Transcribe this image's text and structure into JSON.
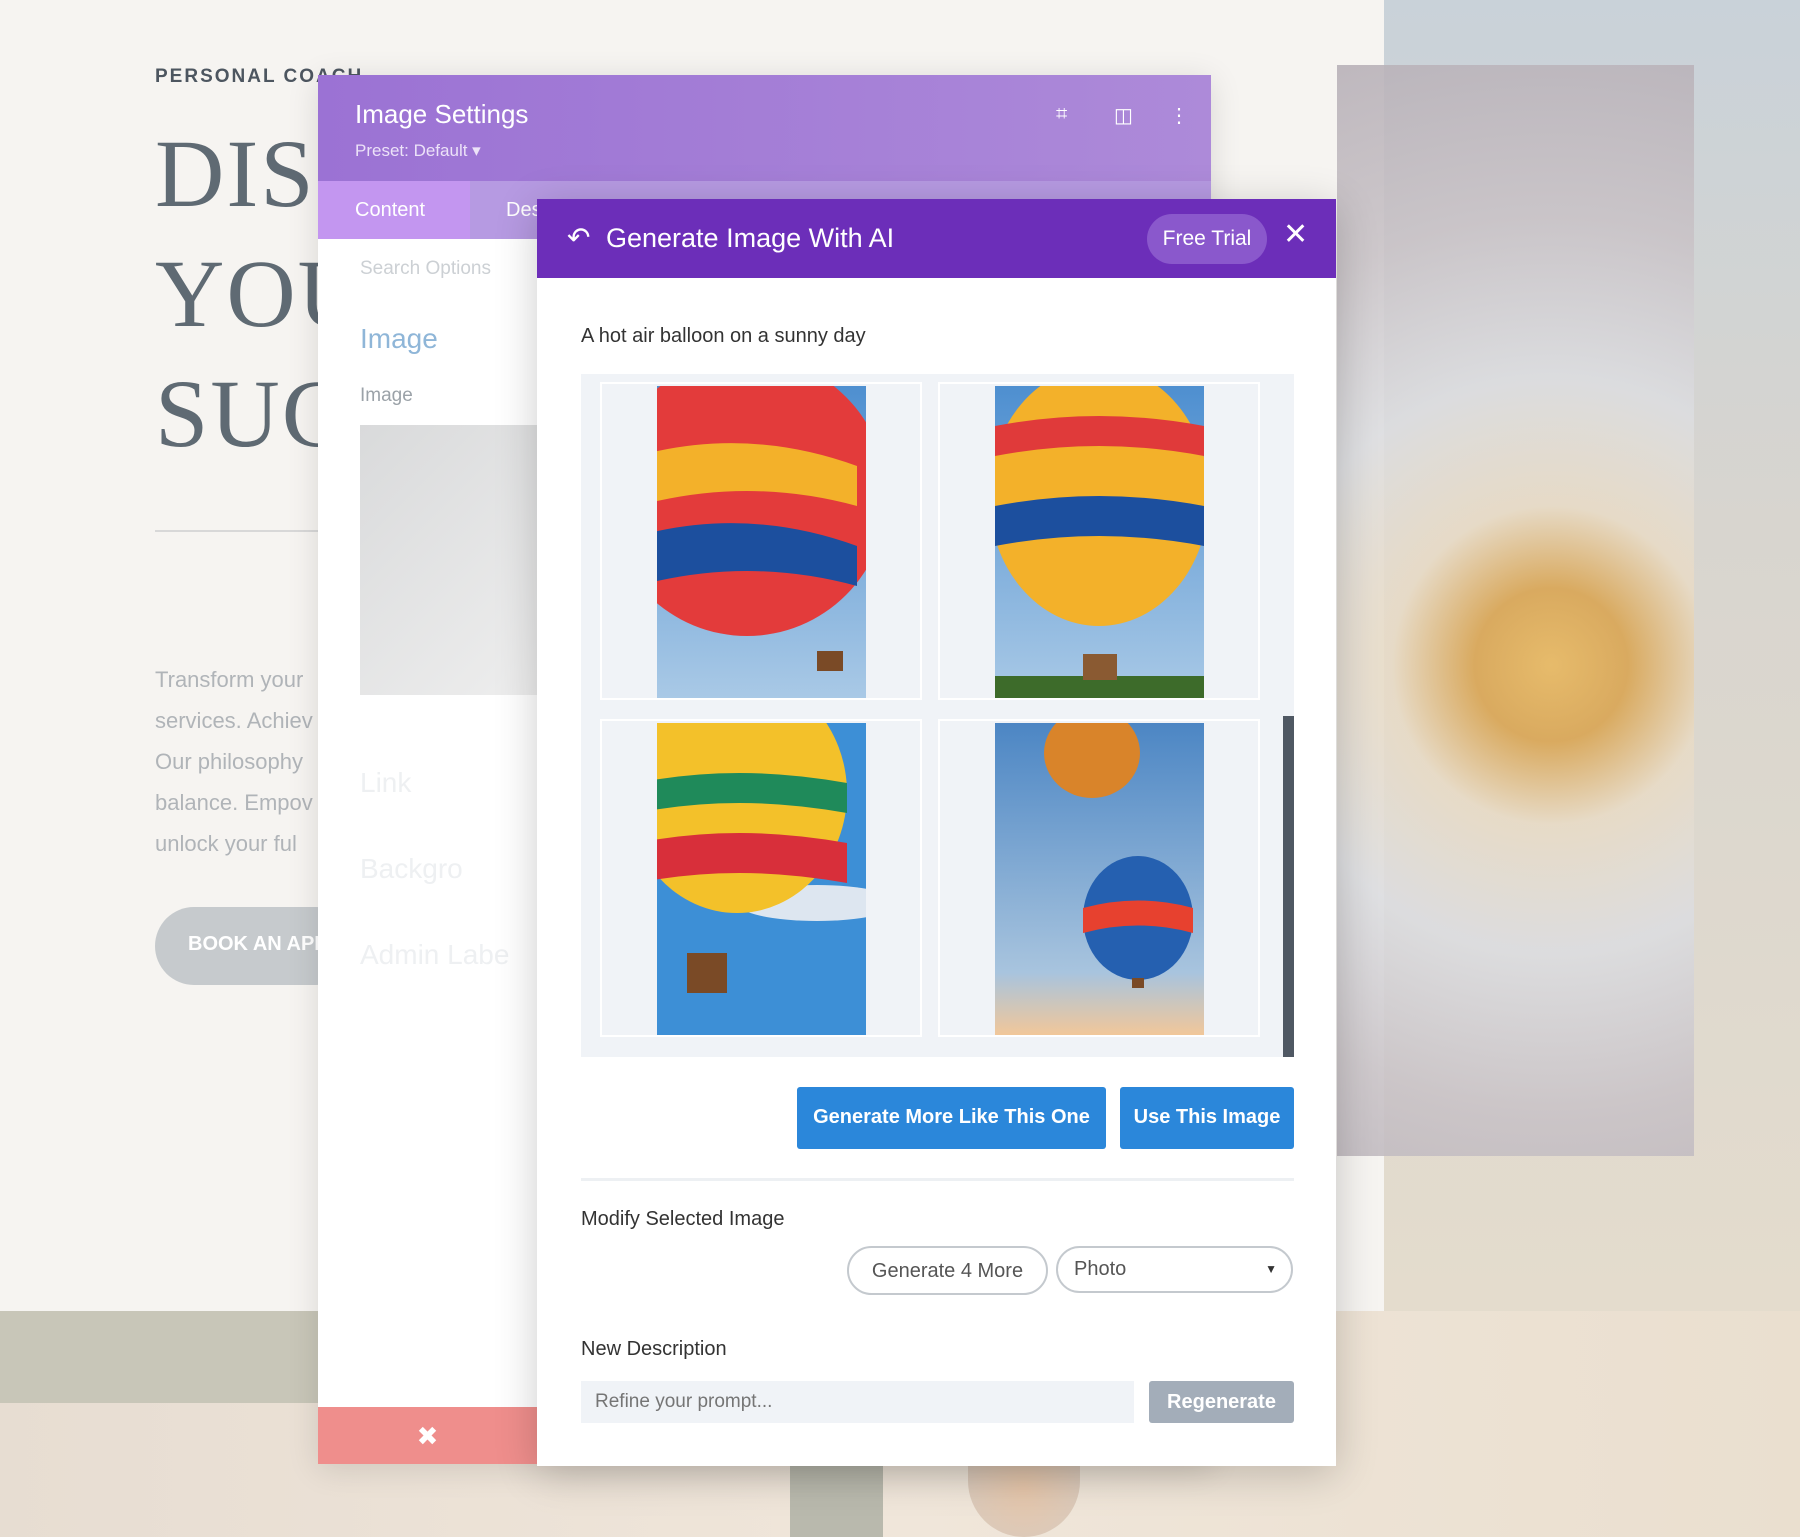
{
  "background": {
    "eyebrow": "PERSONAL COACH",
    "headline_lines": [
      "DISC",
      "YOU",
      "SUC"
    ],
    "paragraph_lines": [
      "Transform your",
      "services. Achiev",
      "Our philosophy",
      "balance. Empov",
      "unlock your ful"
    ],
    "cta": "BOOK AN APP"
  },
  "settings_panel": {
    "title": "Image Settings",
    "preset": "Preset: Default ▾",
    "icons": [
      "focus-icon",
      "split-view-icon",
      "more-vertical-icon"
    ],
    "tabs": [
      {
        "label": "Content",
        "active": true
      },
      {
        "label": "Des"
      }
    ],
    "search_placeholder": "Search Options",
    "section": "Image",
    "field_label": "Image",
    "faded_sections": [
      "Link",
      "Backgro",
      "Admin Labe"
    ],
    "discard_icon": "✖"
  },
  "modal": {
    "title": "Generate Image With AI",
    "free_trial": "Free Trial",
    "prompt": "A hot air balloon on a sunny day",
    "images": [
      {
        "alt": "balloon-1",
        "selected": false
      },
      {
        "alt": "balloon-2",
        "selected": false
      },
      {
        "alt": "balloon-3",
        "selected": false
      },
      {
        "alt": "balloon-4",
        "selected": false
      }
    ],
    "generate_more_like": "Generate More Like This One",
    "use_image": "Use This Image",
    "modify_label": "Modify Selected Image",
    "generate_4_more": "Generate 4 More",
    "style_select": "Photo",
    "new_description_label": "New Description",
    "refine_placeholder": "Refine your prompt...",
    "regenerate": "Regenerate",
    "colors": {
      "header": "#6c2eb9",
      "primary": "#2b87da",
      "disabled": "#a3adb9"
    }
  }
}
